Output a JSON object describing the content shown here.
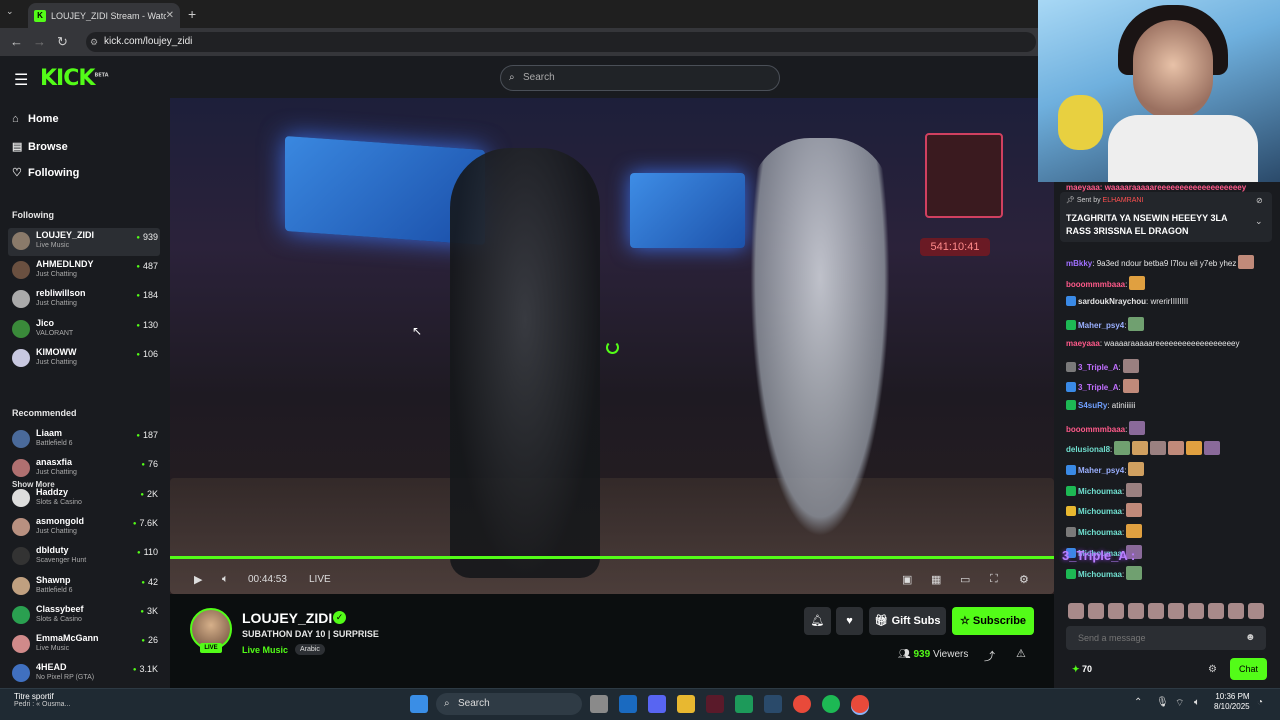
{
  "browser": {
    "tab_title": "LOUJEY_ZIDI Stream - Watch Li",
    "url": "kick.com/loujey_zidi"
  },
  "kick": {
    "logo": "KICK",
    "logo_badge": "BETA",
    "search_placeholder": "Search",
    "nav": [
      {
        "label": "Home",
        "icon": "home-icon"
      },
      {
        "label": "Browse",
        "icon": "browse-icon"
      },
      {
        "label": "Following",
        "icon": "heart-icon"
      }
    ],
    "following_header": "Following",
    "following": [
      {
        "name": "LOUJEY_ZIDI",
        "category": "Live Music",
        "viewers": "939",
        "color": "#8a7a6a"
      },
      {
        "name": "AHMEDLNDY",
        "category": "Just Chatting",
        "viewers": "487",
        "color": "#6a5040"
      },
      {
        "name": "rebliwillson",
        "category": "Just Chatting",
        "viewers": "184",
        "color": "#aaaaaa"
      },
      {
        "name": "Jico",
        "category": "VALORANT",
        "viewers": "130",
        "color": "#3a8a3a"
      },
      {
        "name": "KIMOWW",
        "category": "Just Chatting",
        "viewers": "106",
        "color": "#c8c8e0"
      }
    ],
    "show_more": "Show More",
    "recommended_header": "Recommended",
    "recommended": [
      {
        "name": "Liaam",
        "category": "Battlefield 6",
        "viewers": "187",
        "color": "#4a6a9a"
      },
      {
        "name": "anasxfia",
        "category": "Just Chatting",
        "viewers": "76",
        "color": "#b07070"
      },
      {
        "name": "Haddzy",
        "category": "Slots & Casino",
        "viewers": "2K",
        "color": "#dddddd"
      },
      {
        "name": "asmongold",
        "category": "Just Chatting",
        "viewers": "7.6K",
        "color": "#b89080"
      },
      {
        "name": "dbIduty",
        "category": "Scavenger Hunt",
        "viewers": "110",
        "color": "#333333"
      },
      {
        "name": "Shawnp",
        "category": "Battlefield 6",
        "viewers": "42",
        "color": "#c0a080"
      },
      {
        "name": "Classybeef",
        "category": "Slots & Casino",
        "viewers": "3K",
        "color": "#2aa050"
      },
      {
        "name": "EmmaMcGann",
        "category": "Live Music",
        "viewers": "26",
        "color": "#d08a8a"
      },
      {
        "name": "4HEAD",
        "category": "No Pixel RP (GTA)",
        "viewers": "3.1K",
        "color": "#4070c0"
      }
    ]
  },
  "player": {
    "time": "00:44:53",
    "live": "LIVE",
    "overlay_timer": "541:10:41"
  },
  "stream": {
    "channel": "LOUJEY_ZIDI",
    "live_tag": "LIVE",
    "title": "SUBATHON DAY 10 | SURPRISE",
    "category": "Live Music",
    "tag": "Arabic",
    "gift_subs": "Gift Subs",
    "subscribe": "Subscribe",
    "viewers": "939",
    "viewers_label": "Viewers"
  },
  "chat": {
    "pinned_by_label": "Sent by",
    "pinned_user": "ELHAMRANI",
    "pinned_message": "TZAGHRITA YA NSEWIN HEEEYY 3LA RASS 3RISSNA EL DRAGON",
    "top_cut": "waaaaraaaaareeeeeeeeeeeeeeeeeeey",
    "messages": [
      {
        "user": "mBkky",
        "color": "#a070ff",
        "text": ": 9a3ed ndour betba9 l7lou eli y7eb yhez",
        "emotes": 1
      },
      {
        "user": "booommmbaaa",
        "color": "#ff5a8a",
        "text": ":",
        "emotes": 1
      },
      {
        "user": "sardoukNraychou",
        "color": "#e6e6e6",
        "text": ": wrerirIIIIIIII",
        "emotes": 0
      },
      {
        "user": "Maher_psy4",
        "color": "#9ab0ff",
        "text": ":",
        "emotes": 1
      },
      {
        "user": "maeyaaa",
        "color": "#ff5a8a",
        "text": ": waaaaraaaaareeeeeeeeeeeeeeeeeey",
        "emotes": 0
      },
      {
        "user": "3_Triple_A",
        "color": "#c070ff",
        "text": ":",
        "emotes": 1
      },
      {
        "user": "3_Triple_A",
        "color": "#c070ff",
        "text": ":",
        "emotes": 1
      },
      {
        "user": "S4suRy",
        "color": "#70a0ff",
        "text": ": atiniiiiii",
        "emotes": 0
      },
      {
        "user": "booommmbaaa",
        "color": "#ff5a8a",
        "text": ":",
        "emotes": 1
      },
      {
        "user": "delusional8",
        "color": "#70e0d0",
        "text": ":",
        "emotes": 6
      },
      {
        "user": "Maher_psy4",
        "color": "#9ab0ff",
        "text": ":",
        "emotes": 1
      },
      {
        "user": "Michoumaa",
        "color": "#70e0d0",
        "text": ":",
        "emotes": 1
      },
      {
        "user": "Michoumaa",
        "color": "#70e0d0",
        "text": ":",
        "emotes": 1
      },
      {
        "user": "Michoumaa",
        "color": "#70e0d0",
        "text": ":",
        "emotes": 1
      },
      {
        "user": "Michoumaa",
        "color": "#70e0d0",
        "text": ":",
        "emotes": 1
      },
      {
        "user": "Michoumaa",
        "color": "#70e0d0",
        "text": ":",
        "emotes": 1
      }
    ],
    "big_name": "3_Triple_A :",
    "input_placeholder": "Send a message",
    "points": "70",
    "chat_button": "Chat"
  },
  "taskbar": {
    "weather_title": "Titre sportif",
    "weather_sub": "Pedri : « Ousma...",
    "search": "Search",
    "time": "10:36 PM",
    "date": "8/10/2025"
  },
  "colors": {
    "accent": "#53fc18",
    "bg": "#0b0e0f",
    "panel": "#191b1f"
  }
}
